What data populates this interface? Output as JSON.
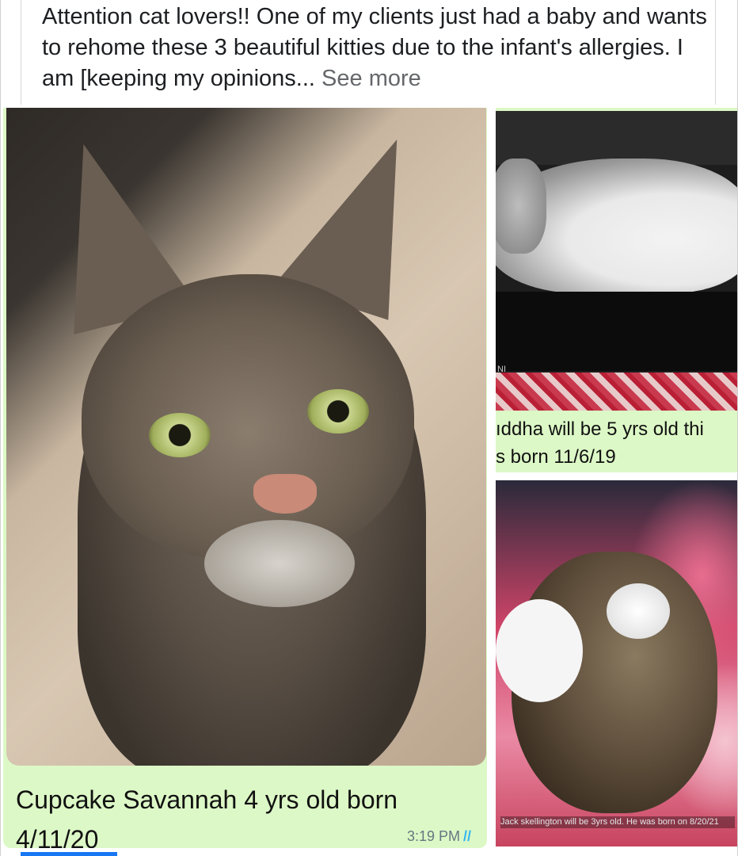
{
  "post": {
    "text": "Attention cat lovers!! One of my clients just had a baby and wants to rehome these 3 beautiful kitties due to the infant's allergies. I am [keeping my opinions...",
    "see_more": "See more"
  },
  "screenshots": [
    {
      "caption": "Cupcake Savannah 4 yrs old born 4/11/20",
      "timestamp": "3:19 PM",
      "ticks": "//"
    },
    {
      "caption_line1": "ıddha will be 5 yrs old thi",
      "caption_line2": "s born 11/6/19",
      "box_label": "NI"
    },
    {
      "caption": "Jack skellington will be 3yrs old. He was born on 8/20/21"
    }
  ],
  "colors": {
    "whatsapp_bubble": "#dcf8c6",
    "see_more": "#65676b",
    "read_ticks": "#34b7f1",
    "accent": "#1877f2"
  }
}
